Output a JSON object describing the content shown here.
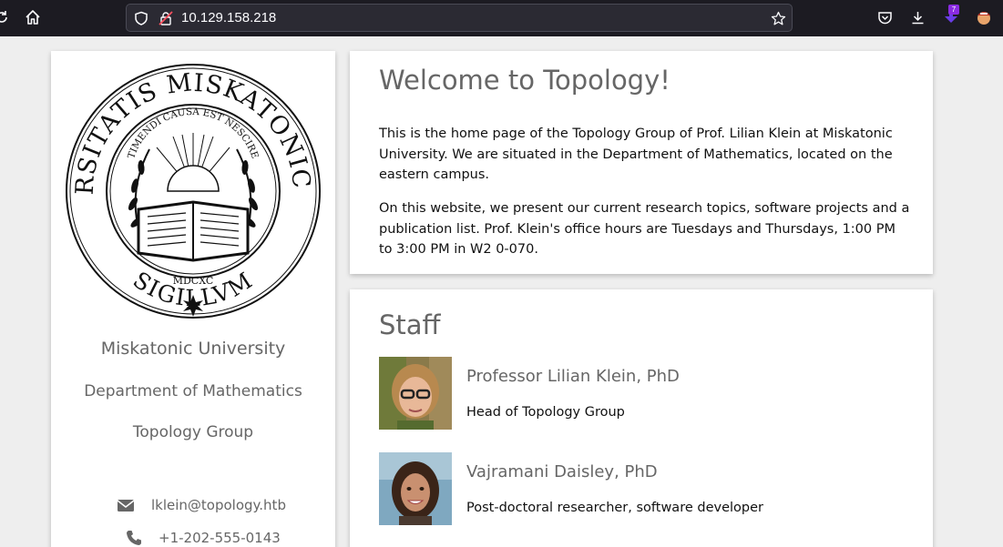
{
  "browser": {
    "url": "10.129.158.218",
    "extension_badge": "7",
    "icons": [
      "reload-icon",
      "home-icon",
      "shield-icon",
      "insecure-lock-icon",
      "bookmark-star-icon",
      "pocket-icon",
      "download-icon",
      "extension-icon",
      "profile-icon"
    ]
  },
  "sidebar": {
    "seal": {
      "outer_text": "UNIVERSITATIS MISKATONICIENSIS",
      "bottom_text": "SIGILLVM",
      "motto": "TIMENDI CAUSA EST NESCIRE",
      "year": "MDCXC"
    },
    "university": "Miskatonic University",
    "department": "Department of Mathematics",
    "group": "Topology Group",
    "email": "lklein@topology.htb",
    "phone": "+1-202-555-0143"
  },
  "welcome": {
    "title": "Welcome to Topology!",
    "paragraph1": "This is the home page of the Topology Group of Prof. Lilian Klein at Miskatonic University. We are situated in the Department of Mathematics, located on the eastern campus.",
    "paragraph2": "On this website, we present our current research topics, software projects and a publication list. Prof. Klein's office hours are Tuesdays and Thursdays, 1:00 PM to 3:00 PM in W2 0-070."
  },
  "staff": {
    "title": "Staff",
    "members": [
      {
        "name": "Professor Lilian Klein, PhD",
        "role": "Head of Topology Group"
      },
      {
        "name": "Vajramani Daisley, PhD",
        "role": "Post-doctoral researcher, software developer"
      }
    ]
  },
  "colors": {
    "page_background": "#eeeeee",
    "card_background": "#ffffff",
    "heading_text": "#666666",
    "body_text": "#111111",
    "toolbar": "#1c1b22",
    "urlbar": "#2b2a33"
  }
}
